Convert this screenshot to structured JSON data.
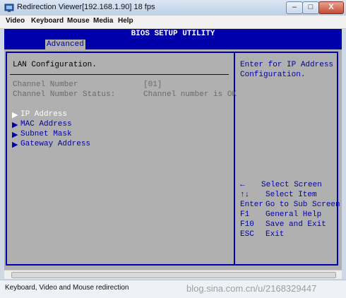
{
  "window": {
    "title": "Redirection Viewer[192.168.1.90]  18 fps",
    "min_label": "–",
    "max_label": "□",
    "close_label": "X"
  },
  "menubar": {
    "items": [
      "Video",
      "Keyboard",
      "Mouse",
      "Media",
      "Help"
    ]
  },
  "bios": {
    "header": "BIOS SETUP UTILITY",
    "active_tab": "Advanced",
    "section_title": "LAN Configuration.",
    "fields": [
      {
        "label": "Channel Number",
        "value": "[01]"
      },
      {
        "label": "Channel Number Status:",
        "value": "Channel number is OK"
      }
    ],
    "submenu": [
      {
        "label": "IP Address",
        "selected": true
      },
      {
        "label": "MAC Address",
        "selected": false
      },
      {
        "label": "Subnet Mask",
        "selected": false
      },
      {
        "label": "Gateway Address",
        "selected": false
      }
    ],
    "help_text": [
      "Enter for IP Address",
      "Configuration."
    ],
    "keys": [
      {
        "key": "←",
        "action": "Select Screen"
      },
      {
        "key": "↑↓",
        "action": "Select Item"
      },
      {
        "key": "Enter",
        "action": "Go to Sub Screen"
      },
      {
        "key": "F1",
        "action": "General Help"
      },
      {
        "key": "F10",
        "action": "Save and Exit"
      },
      {
        "key": "ESC",
        "action": "Exit"
      }
    ]
  },
  "status": {
    "text": "Keyboard, Video and Mouse redirection"
  },
  "watermark": "blog.sina.com.cn/u/2168329447",
  "colors": {
    "bios_blue": "#0000aa",
    "bios_grey": "#b0b0b0"
  }
}
